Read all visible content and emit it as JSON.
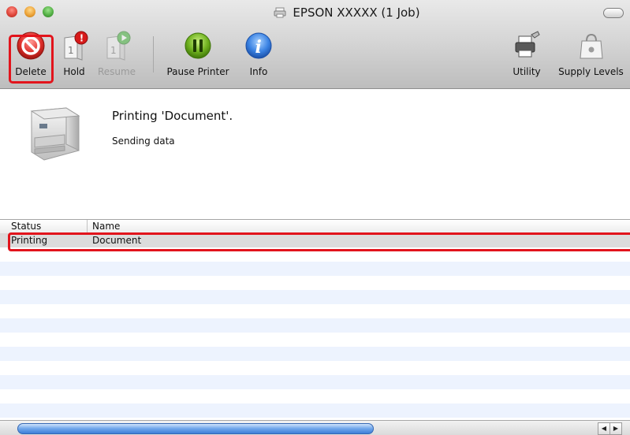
{
  "window": {
    "title": "EPSON XXXXX (1 Job)"
  },
  "toolbar": {
    "delete": "Delete",
    "hold": "Hold",
    "resume": "Resume",
    "pause_printer": "Pause Printer",
    "info": "Info",
    "utility": "Utility",
    "supply_levels": "Supply Levels"
  },
  "status": {
    "title": "Printing 'Document'.",
    "subtitle": "Sending data"
  },
  "job_list": {
    "columns": [
      "Status",
      "Name"
    ],
    "rows": [
      {
        "status": "Printing",
        "name": "Document"
      }
    ]
  },
  "colors": {
    "highlight": "#e2141c",
    "row_stripe": "#edf3fe",
    "selected_row": "#dcdcdc"
  }
}
